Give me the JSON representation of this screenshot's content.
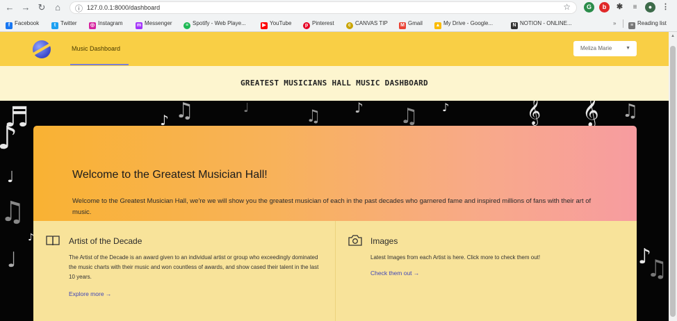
{
  "browser": {
    "url": "127.0.0.1:8000/dashboard",
    "bookmarks": [
      {
        "label": "Facebook",
        "icon": "facebook-icon",
        "color": "#1877f2",
        "glyph": "f"
      },
      {
        "label": "Twitter",
        "icon": "twitter-icon",
        "color": "#1da1f2",
        "glyph": "t"
      },
      {
        "label": "Instagram",
        "icon": "instagram-icon",
        "color": "#d6249f",
        "glyph": "◎"
      },
      {
        "label": "Messenger",
        "icon": "messenger-icon",
        "color": "#a334fa",
        "glyph": "m"
      },
      {
        "label": "Spotify - Web Playe...",
        "icon": "spotify-icon",
        "color": "#1db954",
        "glyph": "≡"
      },
      {
        "label": "YouTube",
        "icon": "youtube-icon",
        "color": "#ff0000",
        "glyph": "▶"
      },
      {
        "label": "Pinterest",
        "icon": "pinterest-icon",
        "color": "#e60023",
        "glyph": "p"
      },
      {
        "label": "CANVAS TIP",
        "icon": "canvas-icon",
        "color": "#c9a400",
        "glyph": "c"
      },
      {
        "label": "Gmail",
        "icon": "gmail-icon",
        "color": "#ea4335",
        "glyph": "M"
      },
      {
        "label": "My Drive - Google...",
        "icon": "google-drive-icon",
        "color": "#fbbc04",
        "glyph": "▲"
      },
      {
        "label": "NOTION - ONLINE...",
        "icon": "notion-icon",
        "color": "#333333",
        "glyph": "N"
      }
    ],
    "reading_list": "Reading list"
  },
  "navbar": {
    "link": "Music Dashboard",
    "user": "Meliza Marie"
  },
  "banner": {
    "title": "GREATEST MUSICIANS HALL MUSIC DASHBOARD"
  },
  "hero": {
    "title": "Welcome to the Greatest Musician Hall!",
    "text": "Welcome to the Greatest Musician Hall, we're we will show you the greatest musician of each in the past decades who garnered fame and inspired millions of fans with their art of music."
  },
  "features": [
    {
      "title": "Artist of the Decade",
      "text": "The Artist of the Decade is an award given to an individual artist or group who exceedingly dominated the music charts with their music and won countless of awards, and show cased their talent in the last 10 years.",
      "link": "Explore more →",
      "icon": "book-icon"
    },
    {
      "title": "Images",
      "text": "Latest Images from each Artist is here. Click more to check them out!",
      "link": "Check them out →",
      "icon": "camera-icon"
    }
  ],
  "colors": {
    "navbar": "#f9cf45",
    "banner": "#fdf5cf",
    "hero_start": "#f9b233",
    "hero_end": "#f79ca0",
    "feature_bg": "#f8e39a",
    "link": "#3f46b8"
  }
}
